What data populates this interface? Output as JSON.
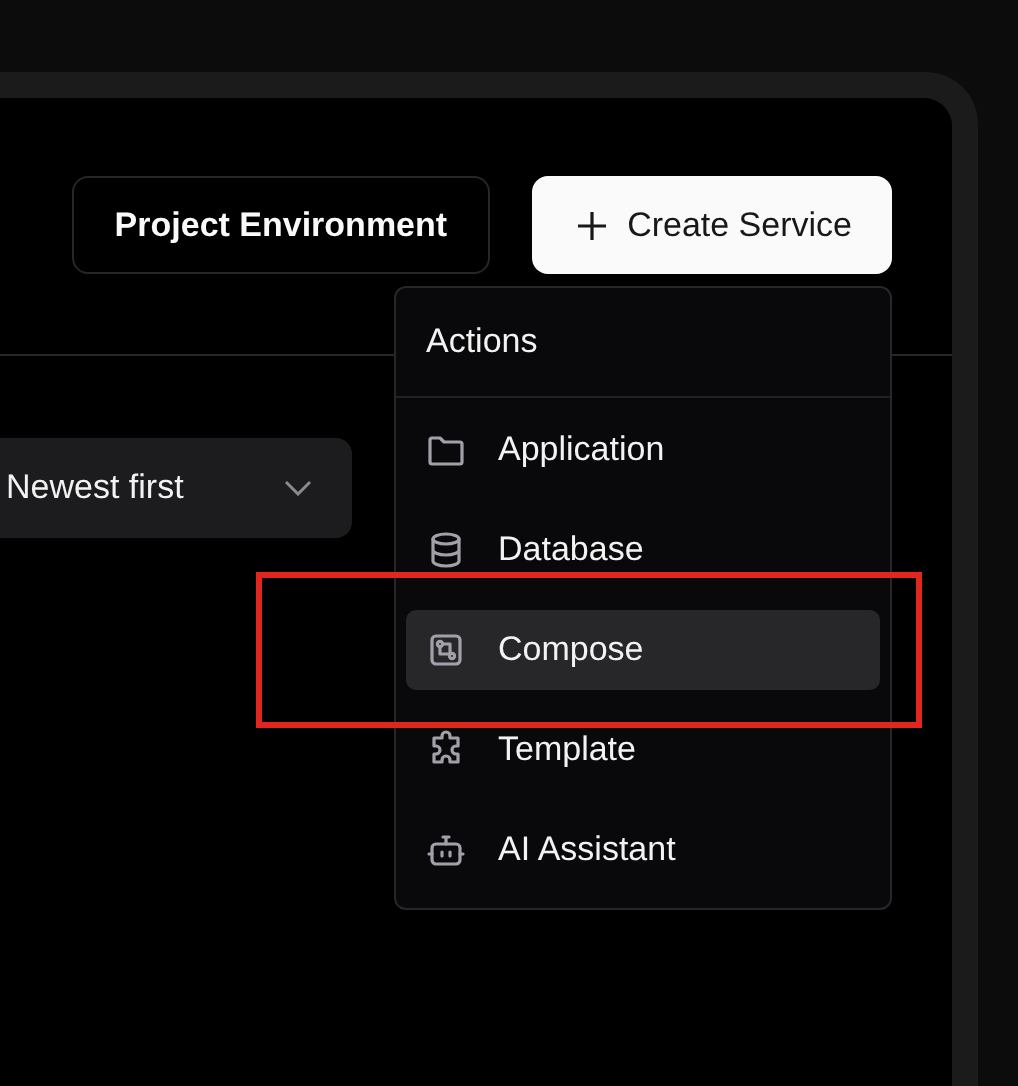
{
  "header_buttons": [
    {
      "label": "Project Environment",
      "kind": "outline"
    },
    {
      "label": "Create Service",
      "kind": "primary",
      "expanded": true
    }
  ],
  "sort": {
    "value": "Newest first"
  },
  "menu": {
    "title": "Actions",
    "items": [
      {
        "label": "Application",
        "kind": "folder",
        "selected": false,
        "highlighted": false
      },
      {
        "label": "Database",
        "kind": "database",
        "selected": false,
        "highlighted": false
      },
      {
        "label": "Compose",
        "kind": "compose",
        "selected": true,
        "highlighted": true
      },
      {
        "label": "Template",
        "kind": "puzzle",
        "selected": false,
        "highlighted": false
      },
      {
        "label": "AI Assistant",
        "kind": "bot",
        "selected": false,
        "highlighted": false
      }
    ]
  }
}
